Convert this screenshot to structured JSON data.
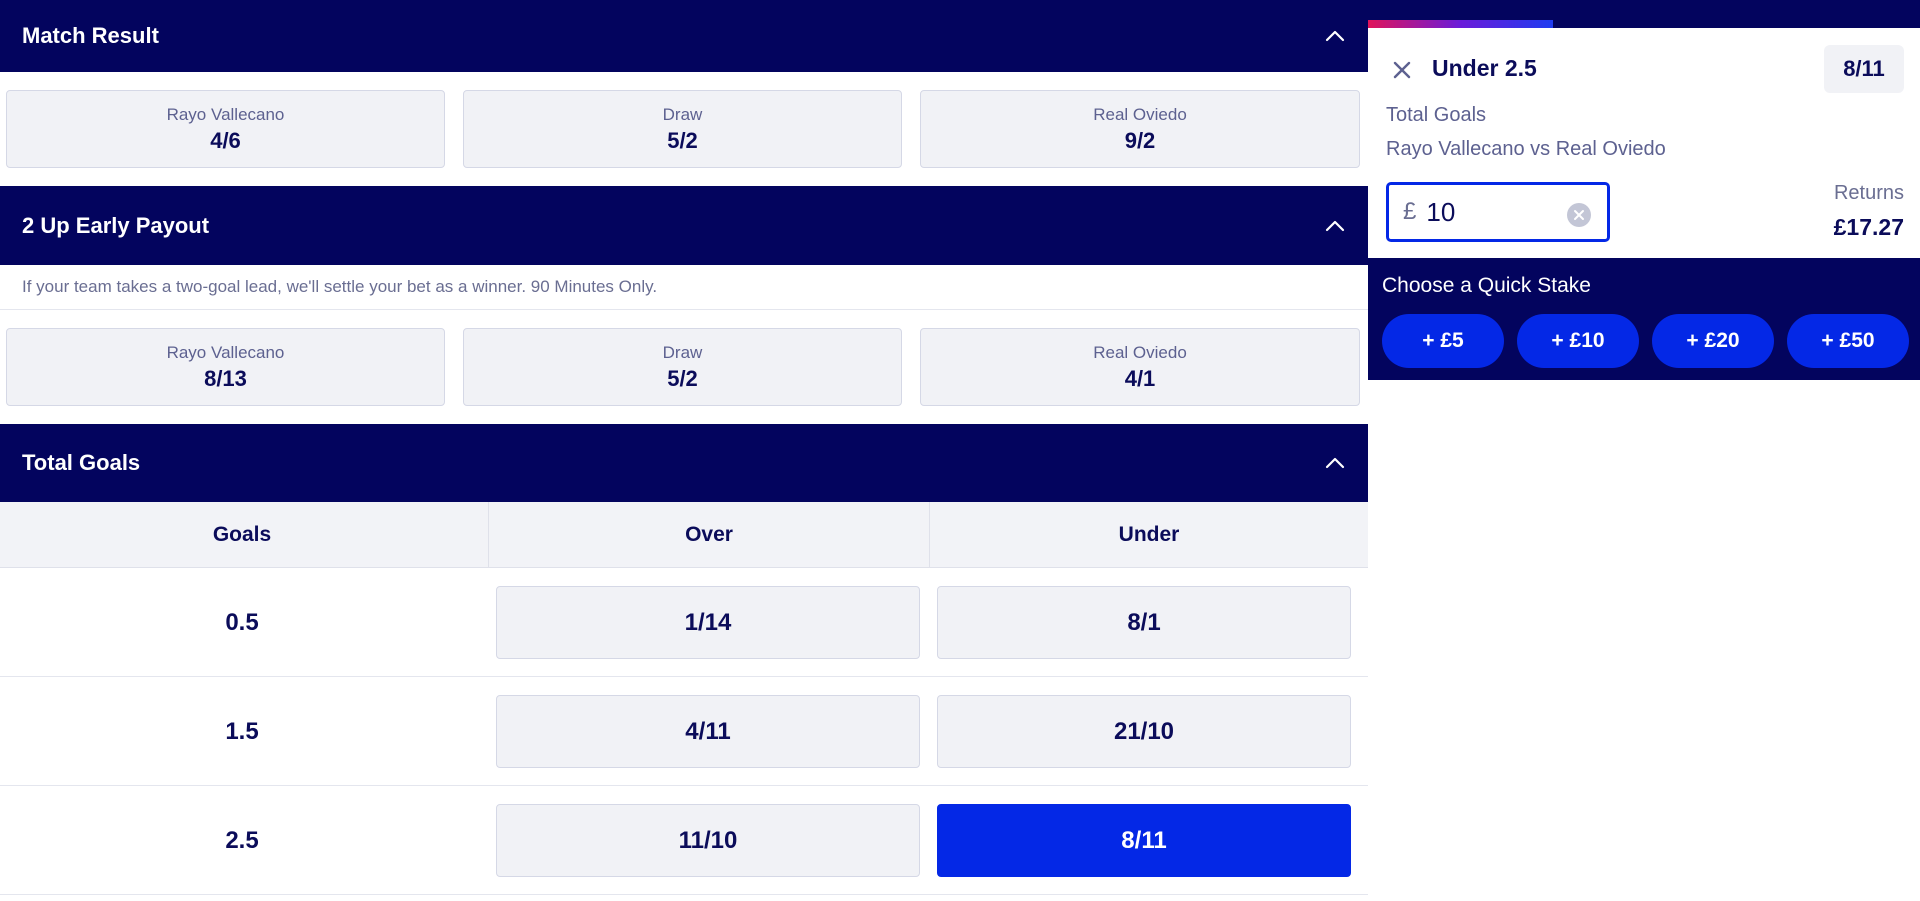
{
  "markets": {
    "match_result": {
      "title": "Match Result",
      "selections": [
        {
          "name": "Rayo Vallecano",
          "odds": "4/6"
        },
        {
          "name": "Draw",
          "odds": "5/2"
        },
        {
          "name": "Real Oviedo",
          "odds": "9/2"
        }
      ]
    },
    "early_payout": {
      "title": "2 Up Early Payout",
      "notice": "If your team takes a two-goal lead, we'll settle your bet as a winner. 90 Minutes Only.",
      "selections": [
        {
          "name": "Rayo Vallecano",
          "odds": "8/13"
        },
        {
          "name": "Draw",
          "odds": "5/2"
        },
        {
          "name": "Real Oviedo",
          "odds": "4/1"
        }
      ]
    },
    "total_goals": {
      "title": "Total Goals",
      "columns": [
        "Goals",
        "Over",
        "Under"
      ],
      "rows": [
        {
          "goals": "0.5",
          "over": "1/14",
          "under": "8/1"
        },
        {
          "goals": "1.5",
          "over": "4/11",
          "under": "21/10"
        },
        {
          "goals": "2.5",
          "over": "11/10",
          "under": "8/11"
        }
      ]
    }
  },
  "betslip": {
    "selection": "Under 2.5",
    "odds": "8/11",
    "market": "Total Goals",
    "event": "Rayo Vallecano vs Real Oviedo",
    "currency": "£",
    "stake": "10",
    "returns_label": "Returns",
    "returns_value": "£17.27",
    "quick_stake": {
      "label": "Choose a Quick Stake",
      "options": [
        "+ £5",
        "+ £10",
        "+ £20",
        "+ £50"
      ]
    }
  },
  "colors": {
    "navy": "#03045e",
    "brand_blue": "#0428e6"
  }
}
